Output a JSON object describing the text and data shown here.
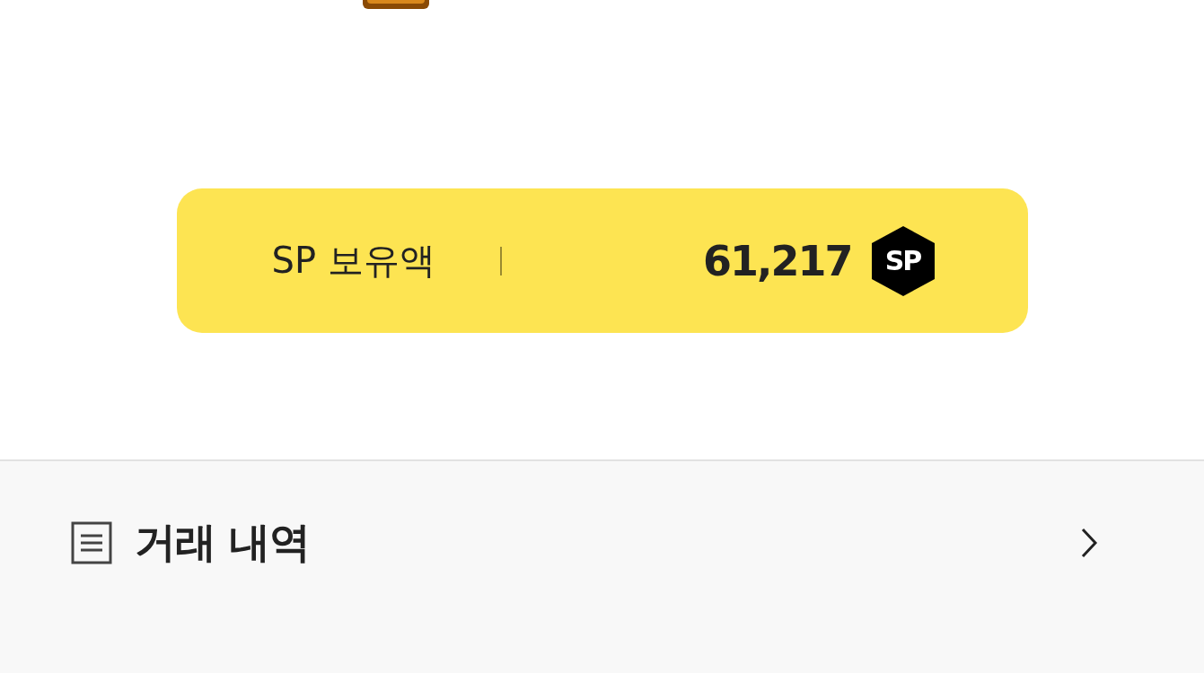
{
  "balance_card": {
    "label": "SP 보유액",
    "amount": "61,217",
    "badge": "SP"
  },
  "menu_items": [
    {
      "label": "거래 내역"
    }
  ]
}
